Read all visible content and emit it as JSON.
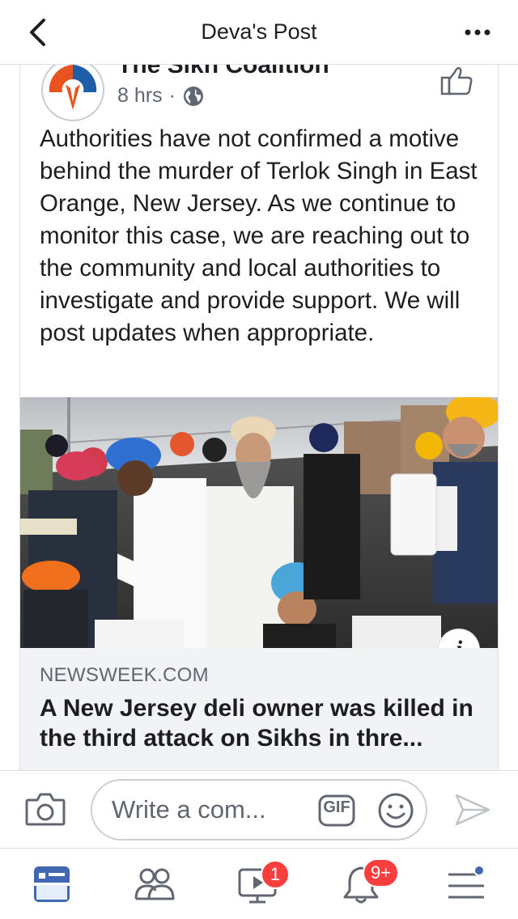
{
  "header": {
    "title": "Deva's Post"
  },
  "post": {
    "author": "The Sikh Coalition",
    "time": "8 hrs",
    "separator": "·",
    "text": "Authorities have not confirmed a motive behind the murder of Terlok Singh in East Orange, New Jersey. As we continue to monitor this case, we are reaching out to the community and local authorities to investigate and provide support. We will post updates when appropriate.",
    "link": {
      "domain": "NEWSWEEK.COM",
      "title": "A New Jersey deli owner was killed in the third attack on Sikhs in thre...",
      "info_icon": "i"
    }
  },
  "comment_bar": {
    "placeholder": "Write a com...",
    "gif_label": "GIF"
  },
  "tabbar": {
    "video_badge": "1",
    "notifications_badge": "9+"
  },
  "colors": {
    "accent": "#4267b2",
    "badge": "#fa3e3e",
    "icon_gray": "#606770"
  }
}
